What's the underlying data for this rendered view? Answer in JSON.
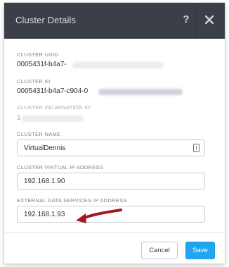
{
  "dialog": {
    "title": "Cluster Details",
    "help_icon": "?",
    "close_icon": "close-icon"
  },
  "fields": {
    "uuid": {
      "label": "CLUSTER UUID",
      "value": "0005431f-b4a7-"
    },
    "id": {
      "label": "CLUSTER ID",
      "value": "0005431f-b4a7-c904-0"
    },
    "incarnation": {
      "label": "CLUSTER INCARNATION ID",
      "value": "1"
    },
    "name": {
      "label": "CLUSTER NAME",
      "value": "VirtualDennis"
    },
    "virtual_ip": {
      "label": "CLUSTER VIRTUAL IP ADDRESS",
      "value": "192.168.1.90"
    },
    "data_services_ip": {
      "label": "EXTERNAL DATA SERVICES IP ADDRESS",
      "value": "192.168.1.93"
    }
  },
  "buttons": {
    "cancel": "Cancel",
    "save": "Save"
  },
  "colors": {
    "titlebar": "#3b3f47",
    "save_button": "#22a5f1",
    "annotation_arrow": "#a31a1f"
  }
}
